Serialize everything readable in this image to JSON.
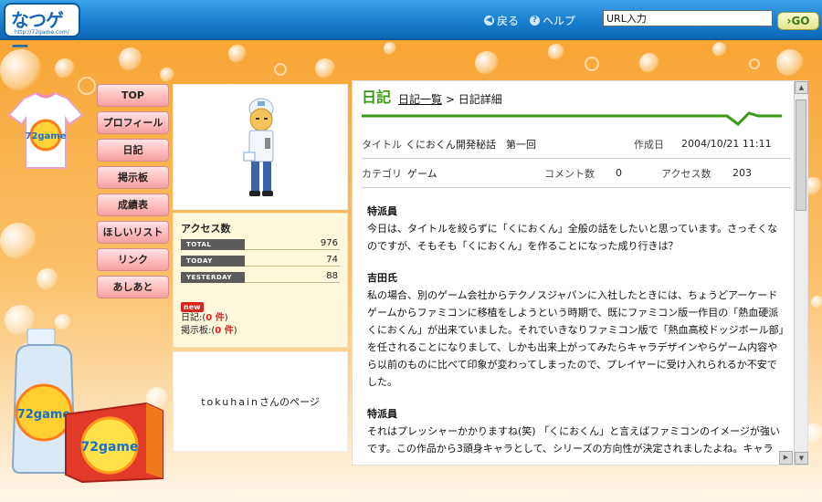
{
  "header": {
    "logo_main": "なつゲー",
    "logo_url": "http://72game.com/",
    "nav_back": "戻る",
    "nav_help": "ヘルプ",
    "url_input_value": "URL入力",
    "go_label": "GO"
  },
  "decor": {
    "tshirt_logo": "72game",
    "bottle_logo": "72game",
    "box_logo": "72game"
  },
  "menu": {
    "items": [
      {
        "label": "TOP"
      },
      {
        "label": "プロフィール"
      },
      {
        "label": "日記"
      },
      {
        "label": "掲示板"
      },
      {
        "label": "成績表"
      },
      {
        "label": "ほしいリスト"
      },
      {
        "label": "リンク"
      },
      {
        "label": "あしあと"
      }
    ]
  },
  "access": {
    "title": "アクセス数",
    "total_label": "TOTAL",
    "total_value": "976",
    "today_label": "TODAY",
    "today_value": "74",
    "yesterday_label": "YESTERDAY",
    "yesterday_value": "88",
    "new_badge": "new",
    "diary_label": "日記:",
    "diary_open": "(",
    "diary_count": "0 件",
    "diary_close": ")",
    "board_label": "掲示板:",
    "board_open": "(",
    "board_count": "0 件",
    "board_close": ")"
  },
  "owner": {
    "name": "tokuhain",
    "suffix": "さんのページ"
  },
  "diary": {
    "section_title": "日記",
    "crumb_list": "日記一覧",
    "crumb_sep": ">",
    "crumb_detail": "日記詳細",
    "meta": {
      "title_label": "タイトル",
      "title_value": "くにおくん開発秘話　第一回",
      "created_label": "作成日",
      "created_value": "2004/10/21 11:11",
      "category_label": "カテゴリ",
      "category_value": "ゲーム",
      "comments_label": "コメント数",
      "comments_value": "0",
      "access_label": "アクセス数",
      "access_value": "203"
    },
    "entries": [
      {
        "speaker": "特派員",
        "text": "今日は、タイトルを絞らずに「くにおくん」全般の話をしたいと思っています。さっそくなのですが、そもそも「くにおくん」を作ることになった成り行きは？"
      },
      {
        "speaker": "吉田氏",
        "text": "私の場合、別のゲーム会社からテクノスジャパンに入社したときには、ちょうどアーケードゲームからファミコンに移植をしようという時期で、既にファミコン版一作目の「熱血硬派くにおくん」が出来ていました。それでいきなりファミコン版で「熱血高校ドッジボール部」を任されることになりまして、しかも出来上がってみたらキャラデザインやらゲーム内容やら以前のものに比べて印象が変わってしまったので、プレイヤーに受け入れられるか不安でした。"
      },
      {
        "speaker": "特派員",
        "text": "それはプレッシャーかかりますね(笑) 「くにおくん」と言えばファミコンのイメージが強いです。この作品から3頭身キャラとして、シリーズの方向性が決定されましたよね。キャラ"
      }
    ]
  },
  "colors": {
    "accent_green": "#3a9a16",
    "header_blue": "#1a7fd0",
    "menu_pink": "#ffbcbc",
    "new_red": "#d8231f"
  }
}
